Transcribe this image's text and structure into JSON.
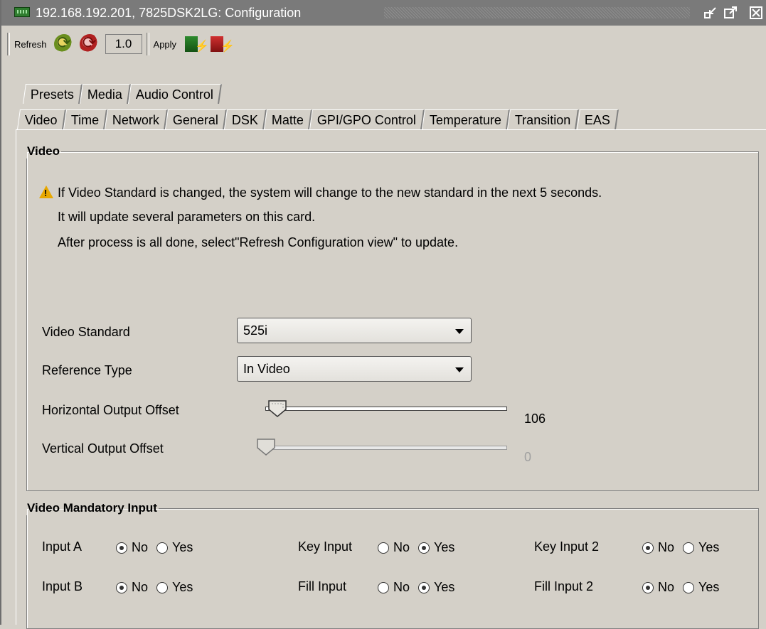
{
  "window": {
    "title": "192.168.192.201, 7825DSK2LG: Configuration"
  },
  "toolbar": {
    "refresh_label": "Refresh",
    "zoom_value": "1.0",
    "apply_label": "Apply"
  },
  "tabs": {
    "row1": [
      "Presets",
      "Media",
      "Audio Control"
    ],
    "row2": [
      "Video",
      "Time",
      "Network",
      "General",
      "DSK",
      "Matte",
      "GPI/GPO Control",
      "Temperature",
      "Transition",
      "EAS"
    ],
    "active": "Video"
  },
  "video_group": {
    "title": "Video",
    "warning_lines": [
      "If Video Standard is changed, the system will change to the new standard in the next 5 seconds.",
      "It will update several parameters on this card.",
      "After process is all done, select\"Refresh Configuration view\" to update."
    ],
    "video_standard_label": "Video Standard",
    "video_standard_value": "525i",
    "reference_type_label": "Reference Type",
    "reference_type_value": "In Video",
    "h_offset_label": "Horizontal Output Offset",
    "h_offset_value": "106",
    "v_offset_label": "Vertical Output Offset",
    "v_offset_value": "0"
  },
  "mandatory_group": {
    "title": "Video Mandatory Input",
    "no_label": "No",
    "yes_label": "Yes",
    "inputs": [
      {
        "label": "Input A",
        "selected": "No"
      },
      {
        "label": "Key Input",
        "selected": "Yes"
      },
      {
        "label": "Key Input 2",
        "selected": "No"
      },
      {
        "label": "Input B",
        "selected": "No"
      },
      {
        "label": "Fill Input",
        "selected": "Yes"
      },
      {
        "label": "Fill Input 2",
        "selected": "No"
      }
    ]
  }
}
